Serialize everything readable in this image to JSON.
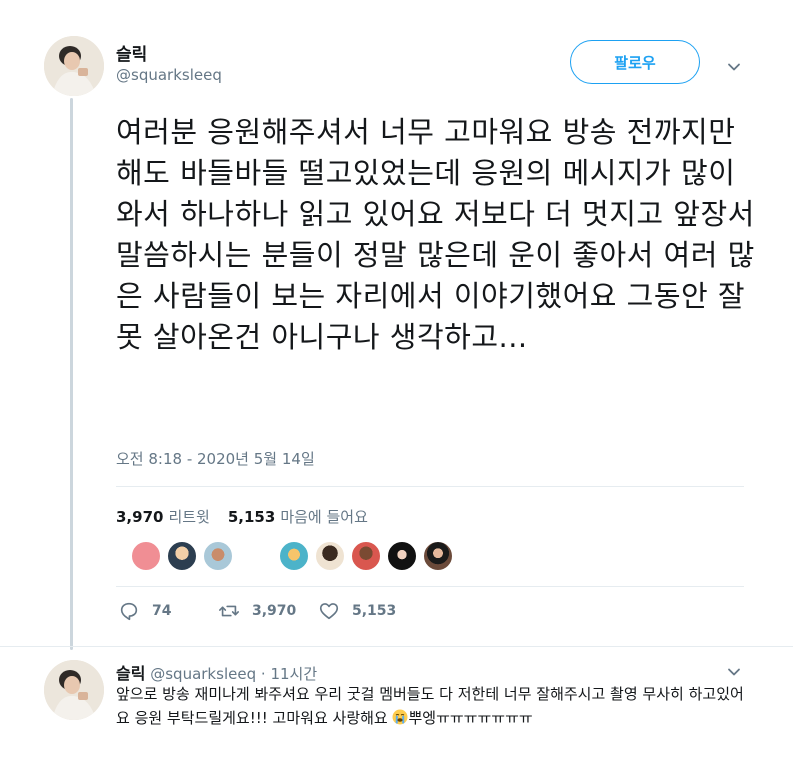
{
  "tweet": {
    "author_name": "슬릭",
    "author_handle": "@squarksleeq",
    "follow_label": "팔로우",
    "text": "여러분 응원해주셔서 너무 고마워요 방송 전까지만 해도 바들바들 떨고있었는데 응원의 메시지가 많이 와서 하나하나 읽고 있어요 저보다 더 멋지고 앞장서 말씀하시는 분들이 정말 많은데 운이 좋아서 여러 많은 사람들이 보는 자리에서 이야기했어요 그동안 잘못 살아온건 아니구나 생각하고...",
    "timestamp": "오전 8:18 - 2020년 5월 14일",
    "retweet_count": "3,970",
    "retweet_label": "리트윗",
    "like_count": "5,153",
    "like_label": "마음에 들어요",
    "actions": {
      "reply_count": "74",
      "retweet_count": "3,970",
      "like_count": "5,153"
    },
    "colors": {
      "accent": "#1da1f2",
      "muted": "#657786"
    },
    "icons": [
      "chevron-down-icon",
      "reply-icon",
      "retweet-icon",
      "heart-icon"
    ]
  },
  "reply": {
    "author_name": "슬릭",
    "author_handle": "@squarksleeq",
    "separator": "·",
    "time": "11시간",
    "text_before_emoji": "앞으로 방송 재미나게 봐주셔요 우리 굿걸 멤버들도 다 저한테 너무 잘해주시고 촬영 무사히 하고있어요 응원 부탁드릴게요!!! 고마워요 사랑해요 ",
    "text_after_emoji": "뿌엥ㅠㅠㅠㅠㅠㅠㅠ",
    "emoji": "loudly-crying-face-icon"
  }
}
